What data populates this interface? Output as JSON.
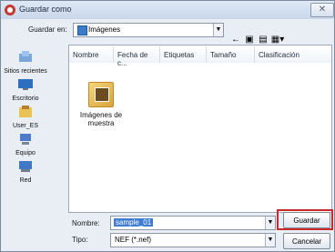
{
  "window": {
    "title": "Guardar como"
  },
  "top": {
    "save_in_label": "Guardar en:",
    "location": "Imágenes"
  },
  "sidebar": [
    {
      "label": "Sitios recientes",
      "icon": "recent-places-icon"
    },
    {
      "label": "Escritorio",
      "icon": "desktop-icon"
    },
    {
      "label": "User_ES",
      "icon": "user-folder-icon"
    },
    {
      "label": "Equipo",
      "icon": "computer-icon"
    },
    {
      "label": "Red",
      "icon": "network-icon"
    }
  ],
  "columns": [
    "Nombre",
    "Fecha de c...",
    "Etiquetas",
    "Tamaño",
    "Clasificación"
  ],
  "files": [
    {
      "name": "Imágenes de muestra"
    }
  ],
  "bottom": {
    "name_label": "Nombre:",
    "name_value": "sample_01",
    "type_label": "Tipo:",
    "type_value": "NEF (*.nef)",
    "save_button": "Guardar",
    "cancel_button": "Cancelar"
  },
  "close_glyph": "✕"
}
